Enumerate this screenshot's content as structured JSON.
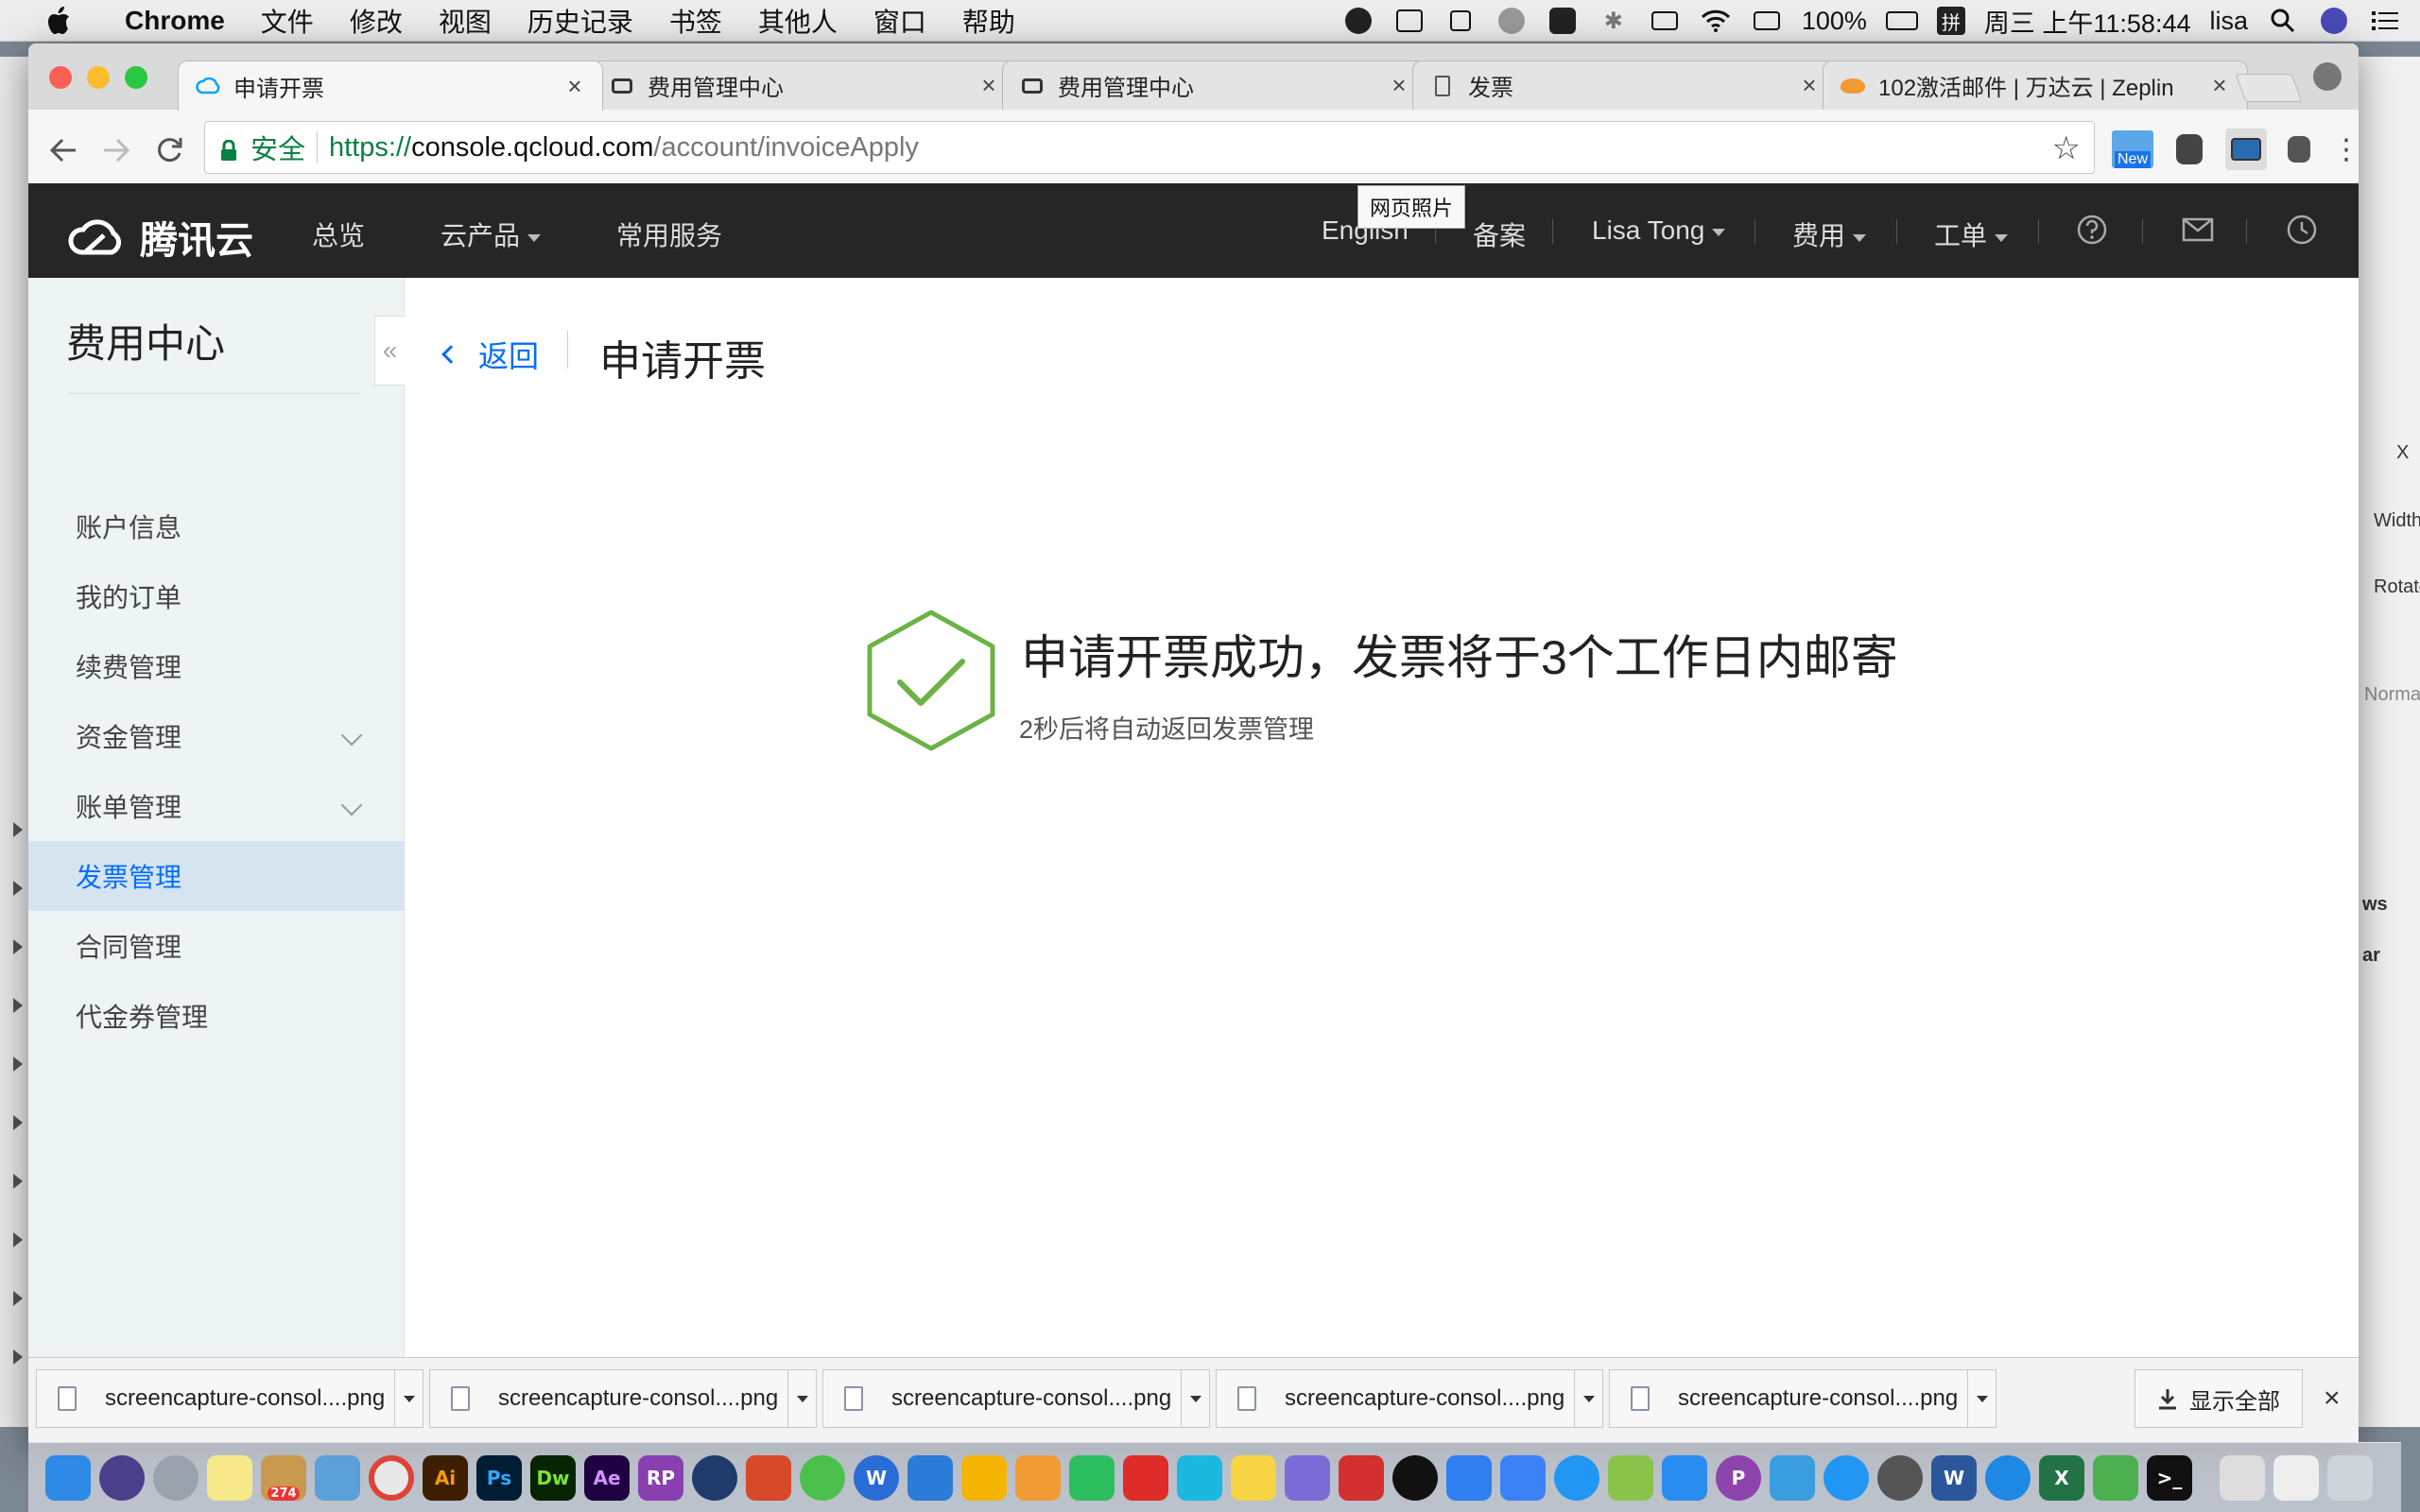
{
  "menubar": {
    "app": "Chrome",
    "items": [
      "文件",
      "修改",
      "视图",
      "历史记录",
      "书签",
      "其他人",
      "窗口",
      "帮助"
    ],
    "battery": "100%",
    "input_method": "拼",
    "clock": "周三 上午11:58:44",
    "user": "lisa"
  },
  "browser": {
    "tabs": [
      {
        "label": "申请开票",
        "active": true
      },
      {
        "label": "费用管理中心",
        "active": false
      },
      {
        "label": "费用管理中心",
        "active": false
      },
      {
        "label": "发票",
        "active": false
      },
      {
        "label": "102激活邮件 | 万达云 | Zeplin",
        "active": false
      }
    ],
    "close_glyph": "×",
    "secure_label": "安全",
    "url": {
      "scheme": "https://",
      "host": "console.qcloud.com",
      "path": "/account/invoiceApply"
    },
    "new_badge": "New",
    "tooltip": "网页照片"
  },
  "header": {
    "brand": "腾讯云",
    "nav": [
      "总览",
      "云产品",
      "常用服务"
    ],
    "right": {
      "lang": "English",
      "beian": "备案",
      "user": "Lisa Tong",
      "fee": "费用",
      "ticket": "工单"
    }
  },
  "sidebar": {
    "title": "费用中心",
    "collapse_glyph": "«",
    "items": [
      {
        "label": "账户信息",
        "active": false,
        "expandable": false
      },
      {
        "label": "我的订单",
        "active": false,
        "expandable": false
      },
      {
        "label": "续费管理",
        "active": false,
        "expandable": false
      },
      {
        "label": "资金管理",
        "active": false,
        "expandable": true
      },
      {
        "label": "账单管理",
        "active": false,
        "expandable": true
      },
      {
        "label": "发票管理",
        "active": true,
        "expandable": false
      },
      {
        "label": "合同管理",
        "active": false,
        "expandable": false
      },
      {
        "label": "代金券管理",
        "active": false,
        "expandable": false
      }
    ]
  },
  "main": {
    "back": "返回",
    "title": "申请开票",
    "success_message": "申请开票成功，发票将于3个工作日内邮寄",
    "success_sub": "2秒后将自动返回发票管理"
  },
  "downloads": {
    "items": [
      "screencapture-consol....png",
      "screencapture-consol....png",
      "screencapture-consol....png",
      "screencapture-consol....png",
      "screencapture-consol....png"
    ],
    "show_all": "显示全部",
    "close": "×"
  },
  "background_window": {
    "labels": [
      "X",
      "Width",
      "Rotate",
      "Norma",
      "ws",
      "ar"
    ]
  },
  "colors": {
    "accent": "#006eff",
    "success": "#6ab344",
    "header_bg": "#262626",
    "sidebar_bg": "#eef3f4",
    "sidebar_active_bg": "#d6e4ef",
    "secure": "#0b8043"
  },
  "dock": {
    "badge": "274"
  }
}
